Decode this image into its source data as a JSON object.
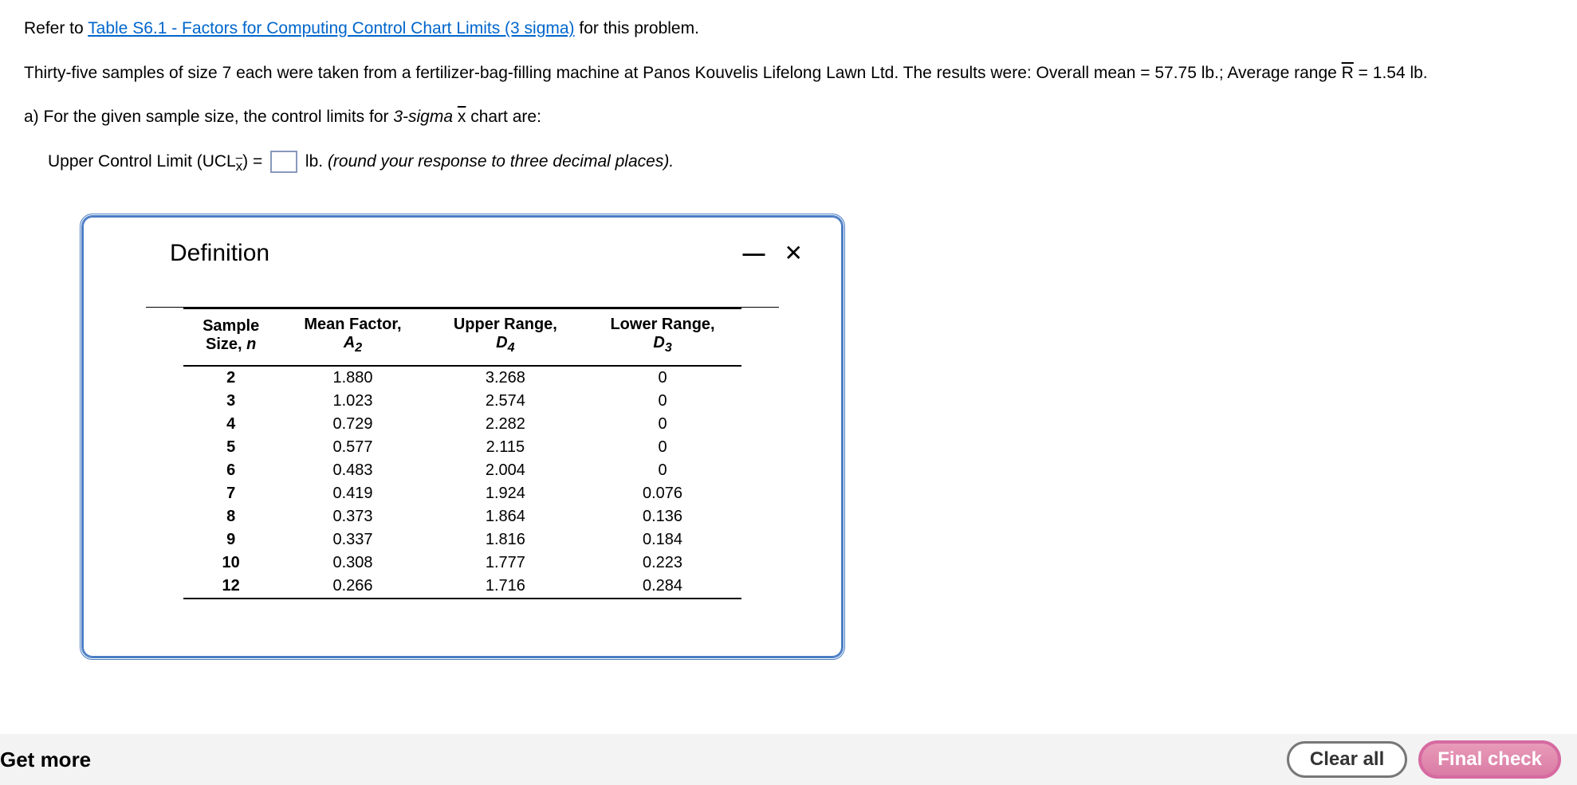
{
  "intro": {
    "refer_prefix": "Refer to ",
    "table_link": "Table S6.1 - Factors for Computing Control Chart Limits (3 sigma)",
    "refer_suffix": " for this problem."
  },
  "problem_text_1": "Thirty-five samples of size 7 each were taken from a fertilizer-bag-filling machine at Panos Kouvelis Lifelong Lawn Ltd. The results were: Overall mean = 57.75 lb.; Average range ",
  "rbar": "R",
  "problem_text_2": " = 1.54 lb.",
  "part_a_prefix": "a) For the given sample size, the control limits for ",
  "part_a_italic": "3-sigma ",
  "xbar": "x",
  "part_a_suffix": " chart are:",
  "ucl_prefix": "Upper Control Limit (UCL",
  "ucl_sub_x": "x",
  "ucl_sub_bar": "̄",
  "ucl_eq": ") = ",
  "ucl_unit": " lb. ",
  "ucl_hint": "(round your response to three decimal places).",
  "modal": {
    "title": "Definition",
    "headers": {
      "h1a": "Sample",
      "h1b": "Size, ",
      "h1c": "n",
      "h2a": "Mean Factor,",
      "h2b": "A",
      "h2sub": "2",
      "h3a": "Upper Range,",
      "h3b": "D",
      "h3sub": "4",
      "h4a": "Lower Range,",
      "h4b": "D",
      "h4sub": "3"
    },
    "rows": [
      {
        "n": "2",
        "a2": "1.880",
        "d4": "3.268",
        "d3": "0"
      },
      {
        "n": "3",
        "a2": "1.023",
        "d4": "2.574",
        "d3": "0"
      },
      {
        "n": "4",
        "a2": "0.729",
        "d4": "2.282",
        "d3": "0"
      },
      {
        "n": "5",
        "a2": "0.577",
        "d4": "2.115",
        "d3": "0"
      },
      {
        "n": "6",
        "a2": "0.483",
        "d4": "2.004",
        "d3": "0"
      },
      {
        "n": "7",
        "a2": "0.419",
        "d4": "1.924",
        "d3": "0.076"
      },
      {
        "n": "8",
        "a2": "0.373",
        "d4": "1.864",
        "d3": "0.136"
      },
      {
        "n": "9",
        "a2": "0.337",
        "d4": "1.816",
        "d3": "0.184"
      },
      {
        "n": "10",
        "a2": "0.308",
        "d4": "1.777",
        "d3": "0.223"
      },
      {
        "n": "12",
        "a2": "0.266",
        "d4": "1.716",
        "d3": "0.284"
      }
    ]
  },
  "bottom": {
    "get_more": "Get more",
    "clear_all": "Clear all",
    "final_check": "Final check"
  }
}
